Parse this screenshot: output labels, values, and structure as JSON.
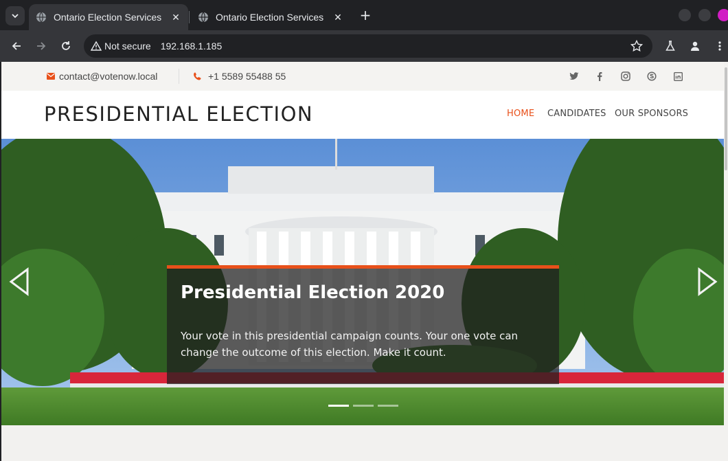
{
  "browser": {
    "tabs": [
      {
        "title": "Ontario Election Services",
        "close": "✕"
      },
      {
        "title": "Ontario Election Services",
        "close": "✕"
      }
    ],
    "new_tab": "+",
    "security_label": "Not secure",
    "url": "192.168.1.185",
    "profile_color": "#d11dc4"
  },
  "topbar": {
    "email": "contact@votenow.local",
    "phone": "+1 5589 55488 55",
    "social": [
      "twitter-icon",
      "facebook-icon",
      "instagram-icon",
      "skype-icon",
      "linkedin-icon"
    ]
  },
  "header": {
    "brand": "PRESIDENTIAL ELECTION",
    "nav": [
      {
        "label": "HOME",
        "active": true
      },
      {
        "label": "CANDIDATES",
        "active": false
      },
      {
        "label": "OUR SPONSORS",
        "active": false
      }
    ],
    "accent": "#e8501a"
  },
  "hero": {
    "title": "Presidential Election 2020",
    "text": "Your vote in this presidential campaign counts. Your one vote can change the outcome of this election. Make it count.",
    "slide_count": 3,
    "active_slide": 1
  }
}
